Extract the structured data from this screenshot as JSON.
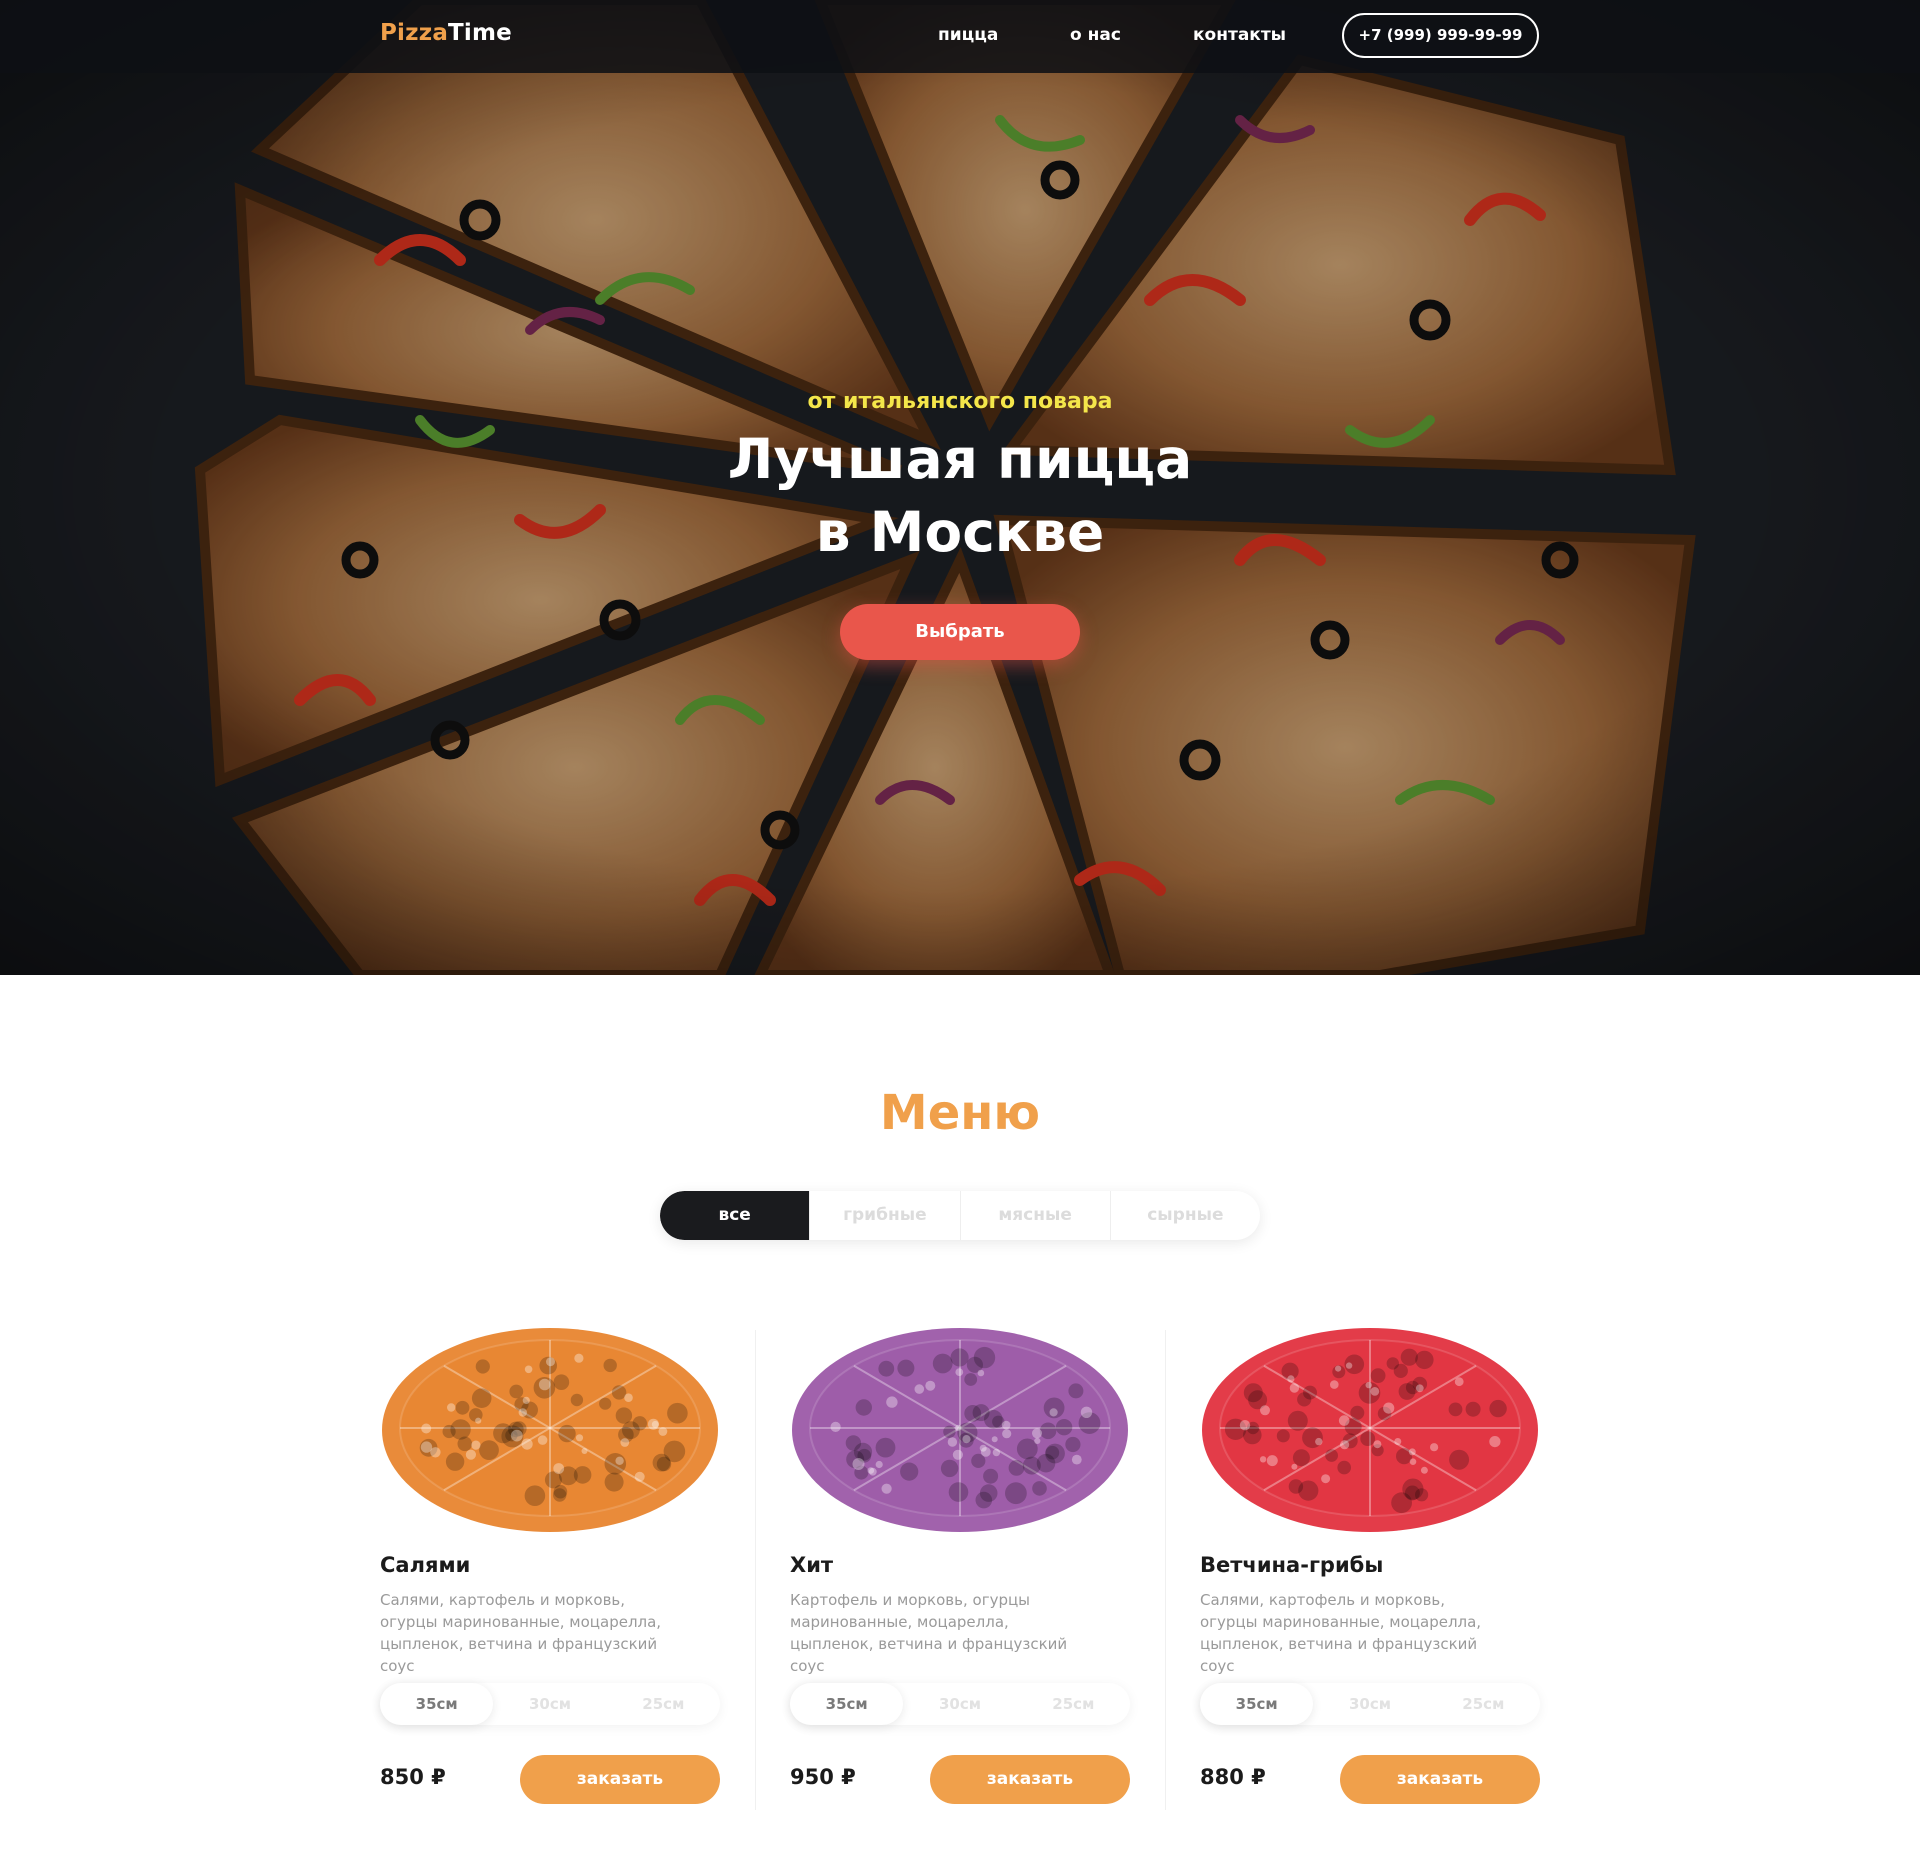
{
  "header": {
    "logo_part1": "Pizza",
    "logo_part2": "Time",
    "nav": [
      "пицца",
      "о нас",
      "контакты"
    ],
    "phone": "+7 (999) 999-99-99"
  },
  "hero": {
    "subtitle": "от итальянского повара",
    "title_line1": "Лучшая пицца",
    "title_line2": "в Москве",
    "button": "Выбрать"
  },
  "menu": {
    "title": "Меню",
    "filters": [
      "все",
      "грибные",
      "мясные",
      "сырные"
    ],
    "active_filter": "все",
    "items": [
      {
        "name": "Салями",
        "description": "Салями, картофель и морковь, огурцы маринованные, моцарелла, цыпленок, ветчина и французский соус",
        "sizes": [
          "35см",
          "30см",
          "25см"
        ],
        "selected_size": "35см",
        "price": "850 ₽",
        "button": "заказать",
        "tint": "#e8852f"
      },
      {
        "name": "Хит",
        "description": "Картофель и морковь, огурцы маринованные, моцарелла, цыпленок, ветчина и французский соус",
        "sizes": [
          "35см",
          "30см",
          "25см"
        ],
        "selected_size": "35см",
        "price": "950 ₽",
        "button": "заказать",
        "tint": "#9c5aa8"
      },
      {
        "name": "Ветчина-грибы",
        "description": "Салями, картофель и морковь, огурцы маринованные, моцарелла, цыпленок, ветчина и французский соус",
        "sizes": [
          "35см",
          "30см",
          "25см"
        ],
        "selected_size": "35см",
        "price": "880 ₽",
        "button": "заказать",
        "tint": "#e2323f"
      }
    ]
  },
  "colors": {
    "accent_orange": "#f0a04b",
    "accent_red": "#e9564b",
    "hero_subtitle_yellow": "#f4e64a",
    "dark": "#1a1b1e"
  }
}
